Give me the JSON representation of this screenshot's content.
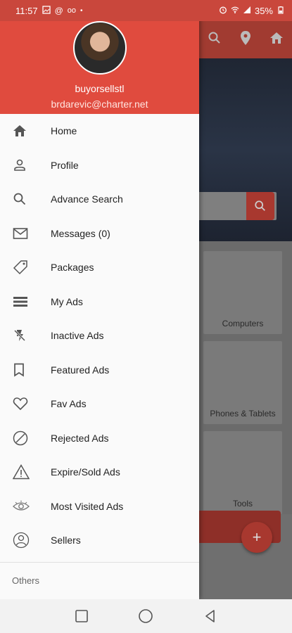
{
  "status_bar": {
    "time": "11:57",
    "battery": "35%"
  },
  "drawer": {
    "username": "buyorsellstl",
    "email": "brdarevic@charter.net",
    "items": [
      {
        "label": "Home",
        "icon": "home-icon"
      },
      {
        "label": "Profile",
        "icon": "person-icon"
      },
      {
        "label": "Advance Search",
        "icon": "search-icon"
      },
      {
        "label": "Messages (0)",
        "icon": "mail-icon"
      },
      {
        "label": "Packages",
        "icon": "tag-icon"
      },
      {
        "label": "My Ads",
        "icon": "list-icon"
      },
      {
        "label": "Inactive Ads",
        "icon": "flash-off-icon"
      },
      {
        "label": "Featured Ads",
        "icon": "bookmark-icon"
      },
      {
        "label": "Fav Ads",
        "icon": "heart-icon"
      },
      {
        "label": "Rejected Ads",
        "icon": "block-icon"
      },
      {
        "label": "Expire/Sold Ads",
        "icon": "warning-icon"
      },
      {
        "label": "Most Visited Ads",
        "icon": "eye-icon"
      },
      {
        "label": "Sellers",
        "icon": "user-circle-icon"
      }
    ],
    "section_others": "Others"
  },
  "background": {
    "categories": [
      "Computers",
      "Phones & Tablets",
      "Tools"
    ],
    "fab_label": "+"
  },
  "colors": {
    "primary": "#e04b3e",
    "drawer_bg": "#fafafa"
  }
}
